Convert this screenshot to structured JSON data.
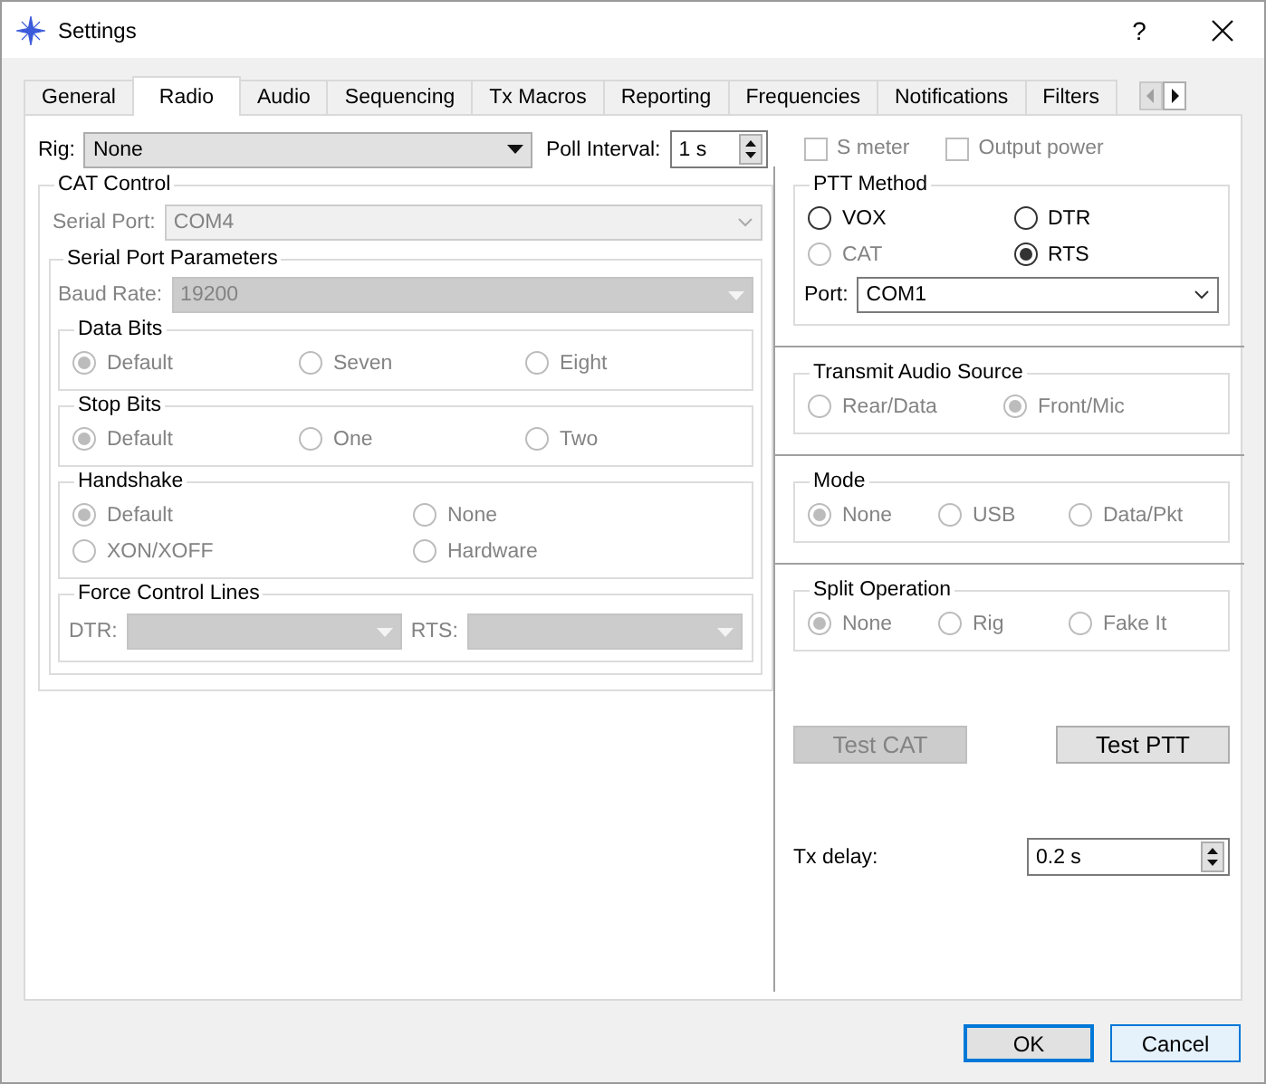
{
  "window": {
    "title": "Settings",
    "help": "?"
  },
  "tabs": [
    {
      "label": "General",
      "selected": false
    },
    {
      "label": "Radio",
      "selected": true
    },
    {
      "label": "Audio",
      "selected": false
    },
    {
      "label": "Sequencing",
      "selected": false
    },
    {
      "label": "Tx Macros",
      "selected": false
    },
    {
      "label": "Reporting",
      "selected": false
    },
    {
      "label": "Frequencies",
      "selected": false
    },
    {
      "label": "Notifications",
      "selected": false
    },
    {
      "label": "Filters",
      "selected": false
    }
  ],
  "rig": {
    "label": "Rig:",
    "value": "None",
    "kind": "button",
    "disabled": false
  },
  "poll_interval": {
    "label": "Poll Interval:",
    "value": "1 s"
  },
  "checkboxes": [
    {
      "label": "S meter",
      "checked": false,
      "disabled": true
    },
    {
      "label": "Output power",
      "checked": false,
      "disabled": true
    }
  ],
  "cat_control": {
    "title": "CAT Control",
    "serial_port": {
      "label": "Serial Port:",
      "value": "COM4",
      "kind": "editable",
      "disabled": true
    },
    "serial_port_parameters": {
      "title": "Serial Port Parameters",
      "baud_rate": {
        "label": "Baud Rate:",
        "value": "19200",
        "kind": "button",
        "disabled": true
      },
      "groups": [
        {
          "title": "Data Bits",
          "rows": [
            [
              {
                "label": "Default",
                "selected": true,
                "disabled": true
              },
              {
                "label": "Seven",
                "selected": false,
                "disabled": true
              },
              {
                "label": "Eight",
                "selected": false,
                "disabled": true
              }
            ]
          ]
        },
        {
          "title": "Stop Bits",
          "rows": [
            [
              {
                "label": "Default",
                "selected": true,
                "disabled": true
              },
              {
                "label": "One",
                "selected": false,
                "disabled": true
              },
              {
                "label": "Two",
                "selected": false,
                "disabled": true
              }
            ]
          ]
        },
        {
          "title": "Handshake",
          "rows": [
            [
              {
                "label": "Default",
                "selected": true,
                "disabled": true
              },
              {
                "label": "None",
                "selected": false,
                "disabled": true
              }
            ],
            [
              {
                "label": "XON/XOFF",
                "selected": false,
                "disabled": true
              },
              {
                "label": "Hardware",
                "selected": false,
                "disabled": true
              }
            ]
          ]
        }
      ],
      "force_control_lines": {
        "title": "Force Control Lines",
        "combos": [
          {
            "label": "DTR:",
            "kind": "button",
            "disabled": true
          },
          {
            "label": "RTS:",
            "kind": "button",
            "disabled": true
          }
        ]
      }
    }
  },
  "ptt_method": {
    "title": "PTT Method",
    "rows": [
      [
        {
          "label": "VOX",
          "selected": false,
          "disabled": false
        },
        {
          "label": "DTR",
          "selected": false,
          "disabled": false
        }
      ],
      [
        {
          "label": "CAT",
          "selected": false,
          "disabled": true
        },
        {
          "label": "RTS",
          "selected": true,
          "disabled": false
        }
      ]
    ],
    "port": {
      "label": "Port:",
      "value": "COM1",
      "kind": "editable",
      "disabled": false
    }
  },
  "sections": [
    {
      "title": "Transmit Audio Source",
      "rows": [
        [
          {
            "label": "Rear/Data",
            "selected": false,
            "disabled": true
          },
          {
            "label": "Front/Mic",
            "selected": true,
            "disabled": true
          }
        ]
      ]
    },
    {
      "title": "Mode",
      "rows": [
        [
          {
            "label": "None",
            "selected": true,
            "disabled": true
          },
          {
            "label": "USB",
            "selected": false,
            "disabled": true
          },
          {
            "label": "Data/Pkt",
            "selected": false,
            "disabled": true
          }
        ]
      ]
    },
    {
      "title": "Split Operation",
      "rows": [
        [
          {
            "label": "None",
            "selected": true,
            "disabled": true
          },
          {
            "label": "Rig",
            "selected": false,
            "disabled": true
          },
          {
            "label": "Fake It",
            "selected": false,
            "disabled": true
          }
        ]
      ]
    }
  ],
  "test_buttons": [
    {
      "label": "Test CAT",
      "disabled": true
    },
    {
      "label": "Test PTT",
      "disabled": false
    }
  ],
  "tx_delay": {
    "label": "Tx delay:",
    "value": "0.2 s"
  },
  "dialog_buttons": [
    {
      "label": "OK",
      "focused": true,
      "hovered": false
    },
    {
      "label": "Cancel",
      "focused": false,
      "hovered": true
    }
  ]
}
